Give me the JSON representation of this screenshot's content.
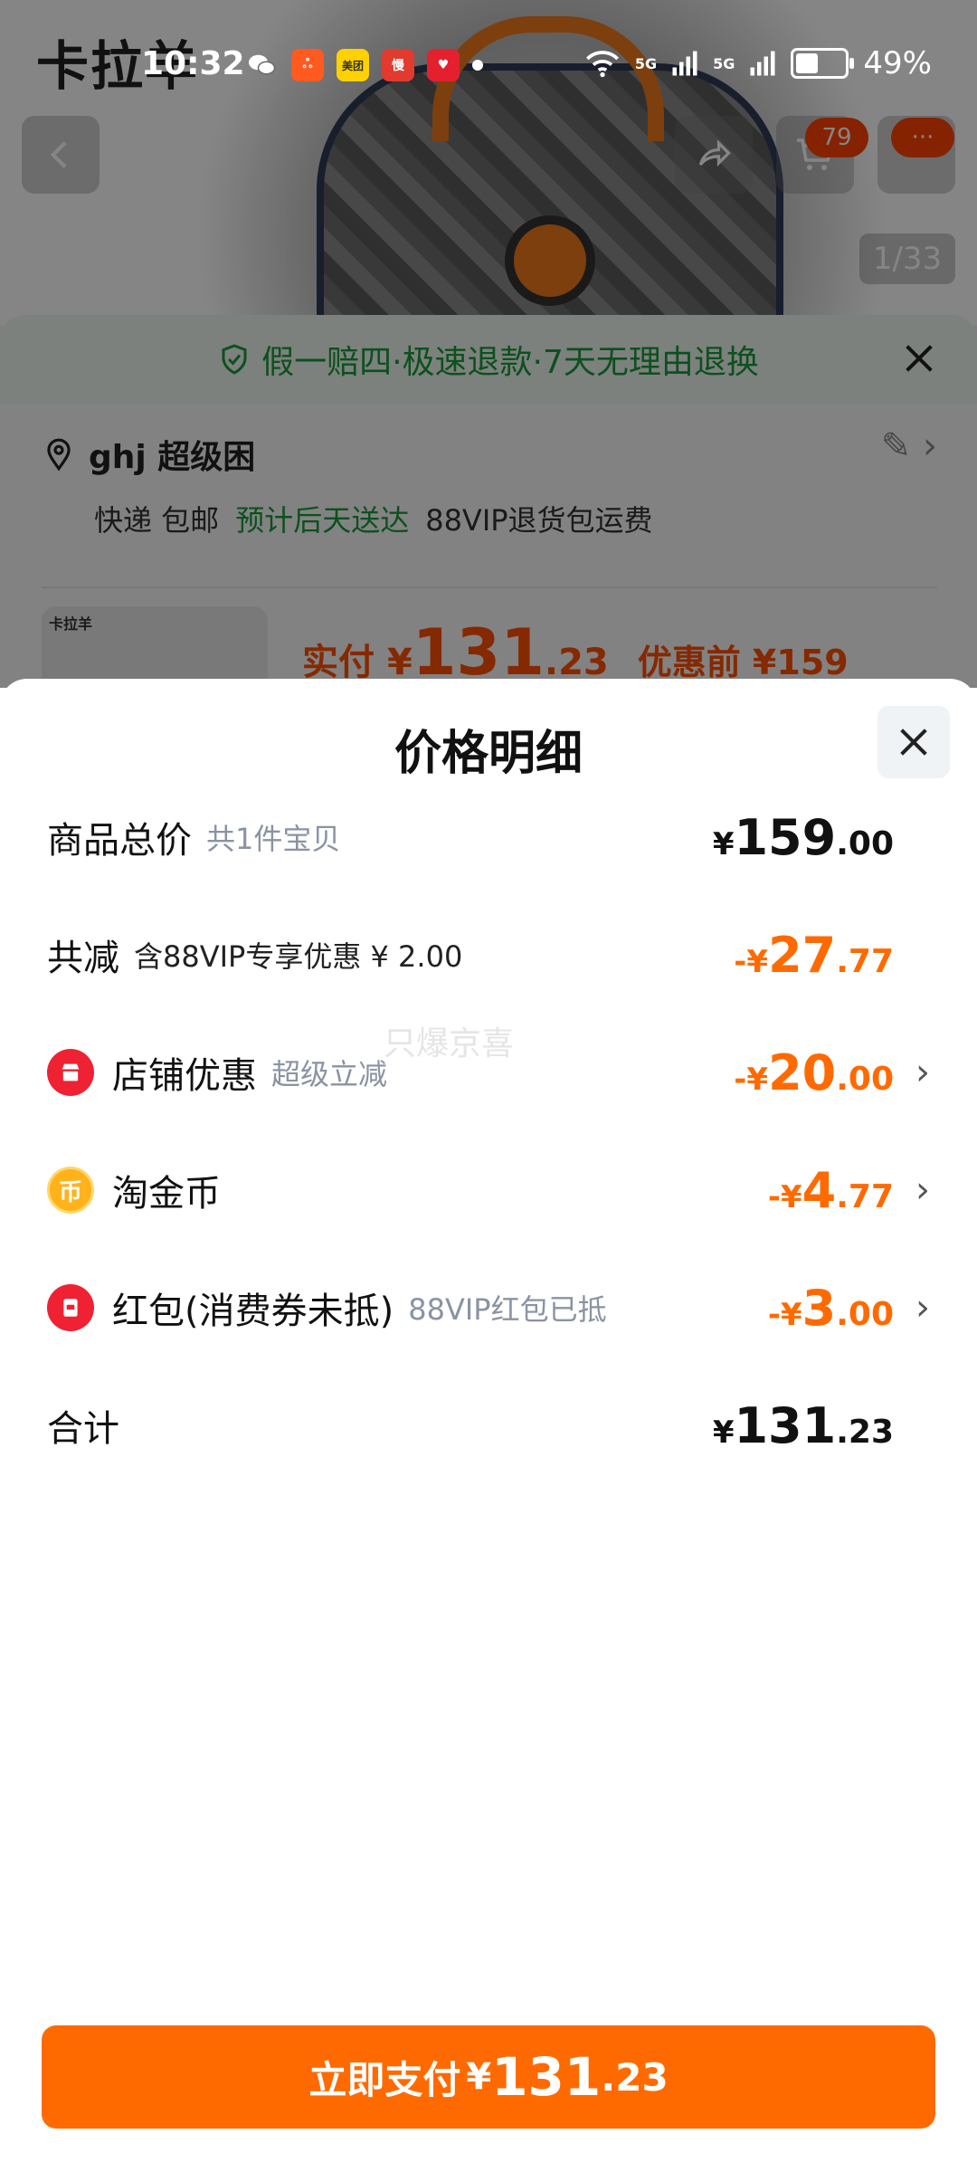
{
  "status_bar": {
    "time": "10:32",
    "battery": "49%",
    "signal1": "5G",
    "signal2": "5G",
    "app_meituan": "美团"
  },
  "product_page": {
    "brand": "卡拉羊",
    "image_counter": "1/33",
    "cart_count": "79",
    "more_label": "···",
    "guarantee": "假一赔四·极速退款·7天无理由退换",
    "address_name": "ghj 超级困",
    "delivery_method": "快递 包邮",
    "delivery_eta": "预计后天送达",
    "return_note": "88VIP退货包运费",
    "thumb_brand": "卡拉羊",
    "pay_label": "实付",
    "pay_currency": "¥",
    "pay_int": "131",
    "pay_dec": ".23",
    "original_price": "优惠前 ¥159"
  },
  "sheet": {
    "title": "价格明细",
    "rows": [
      {
        "label": "商品总价",
        "sub": "共1件宝贝",
        "sign": "",
        "cur": "¥",
        "int": "159",
        "dec": ".00"
      },
      {
        "label": "共减",
        "sub": "含88VIP专享优惠 ¥ 2.00",
        "sign": "-",
        "cur": "¥",
        "int": "27",
        "dec": ".77"
      },
      {
        "label": "店铺优惠",
        "sub": "超级立减",
        "sign": "-",
        "cur": "¥",
        "int": "20",
        "dec": ".00"
      },
      {
        "label": "淘金币",
        "sub": "",
        "sign": "-",
        "cur": "¥",
        "int": "4",
        "dec": ".77"
      },
      {
        "label": "红包(消费券未抵)",
        "sub": "88VIP红包已抵",
        "sign": "-",
        "cur": "¥",
        "int": "3",
        "dec": ".00"
      },
      {
        "label": "合计",
        "sub": "",
        "sign": "",
        "cur": "¥",
        "int": "131",
        "dec": ".23"
      }
    ],
    "watermark": "只爆京喜",
    "pay_button": {
      "label": "立即支付",
      "cur": "¥",
      "int": "131",
      "dec": ".23"
    }
  },
  "colors": {
    "accent": "#ff6a00",
    "discount": "#ff6a00",
    "green": "#1a9a3a",
    "icon_red": "#ee2233"
  }
}
